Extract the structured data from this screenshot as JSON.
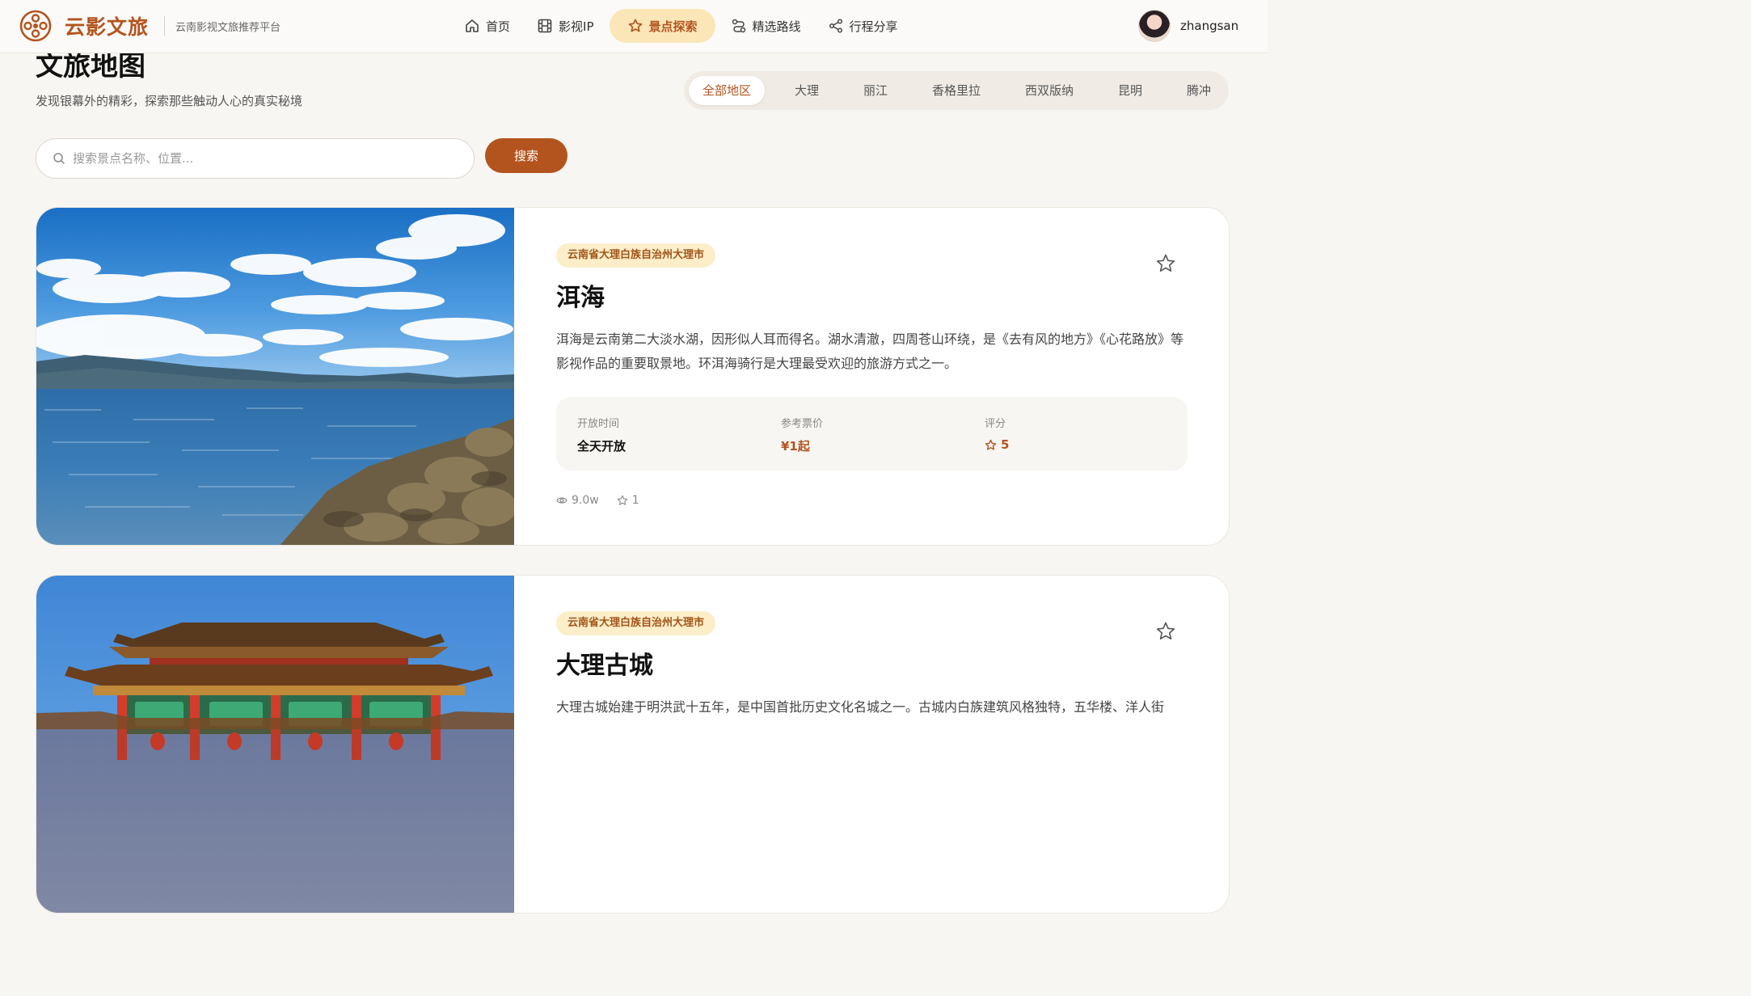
{
  "header": {
    "brand": "云影文旅",
    "tagline": "云南影视文旅推荐平台",
    "nav": [
      {
        "label": "首页",
        "icon": "home-icon"
      },
      {
        "label": "影视IP",
        "icon": "film-icon"
      },
      {
        "label": "景点探索",
        "icon": "star-icon",
        "active": true
      },
      {
        "label": "精选路线",
        "icon": "route-icon"
      },
      {
        "label": "行程分享",
        "icon": "share-icon"
      }
    ],
    "username": "zhangsan"
  },
  "page": {
    "title": "文旅地图",
    "subtitle": "发现银幕外的精彩，探索那些触动人心的真实秘境"
  },
  "regions": [
    "全部地区",
    "大理",
    "丽江",
    "香格里拉",
    "西双版纳",
    "昆明",
    "腾冲"
  ],
  "active_region": "全部地区",
  "search": {
    "placeholder": "搜索景点名称、位置...",
    "button": "搜索"
  },
  "cards": [
    {
      "location": "云南省大理白族自治州大理市",
      "name": "洱海",
      "description": "洱海是云南第二大淡水湖，因形似人耳而得名。湖水清澈，四周苍山环绕，是《去有风的地方》《心花路放》等影视作品的重要取景地。环洱海骑行是大理最受欢迎的旅游方式之一。",
      "open_label": "开放时间",
      "open_value": "全天开放",
      "price_label": "参考票价",
      "price_value": "¥1起",
      "rating_label": "评分",
      "rating_value": "5",
      "views": "9.0w",
      "favorites": "1"
    },
    {
      "location": "云南省大理白族自治州大理市",
      "name": "大理古城",
      "description": "大理古城始建于明洪武十五年，是中国首批历史文化名城之一。古城内白族建筑风格独特，五华楼、洋人街"
    }
  ],
  "colors": {
    "accent": "#b3541e",
    "badge_bg": "#fbeec9",
    "active_nav_bg": "#fbe6b8",
    "page_bg": "#f8f6f2"
  }
}
